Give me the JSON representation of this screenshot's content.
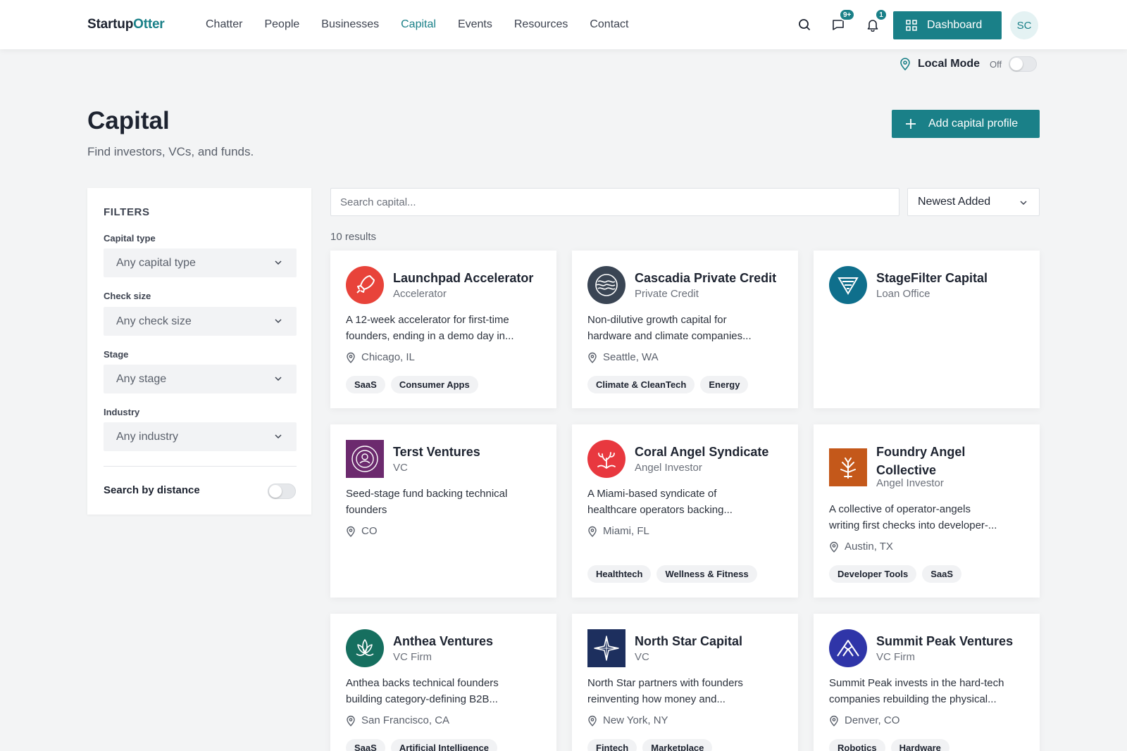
{
  "header": {
    "logo_part1": "Startup",
    "logo_part2": "Otter",
    "nav": [
      "Chatter",
      "People",
      "Businesses",
      "Capital",
      "Events",
      "Resources",
      "Contact"
    ],
    "active_nav": "Capital",
    "messages_badge": "9+",
    "notifications_badge": "1",
    "dashboard_label": "Dashboard",
    "avatar_initials": "SC"
  },
  "local_mode": {
    "label": "Local Mode",
    "state": "Off"
  },
  "page": {
    "title": "Capital",
    "subtitle": "Find investors, VCs, and funds.",
    "add_button": "Add capital profile"
  },
  "filters": {
    "title": "FILTERS",
    "capital_type": {
      "label": "Capital type",
      "value": "Any capital type"
    },
    "check_size": {
      "label": "Check size",
      "value": "Any check size"
    },
    "stage": {
      "label": "Stage",
      "value": "Any stage"
    },
    "industry": {
      "label": "Industry",
      "value": "Any industry"
    },
    "distance_label": "Search by distance"
  },
  "search": {
    "placeholder": "Search capital..."
  },
  "sort": {
    "value": "Newest Added"
  },
  "results_count": "10 results",
  "cards": [
    {
      "name": "Launchpad Accelerator",
      "type": "Accelerator",
      "desc1": "A 12-week accelerator for first-time",
      "desc2": "founders, ending in a demo day in...",
      "location": "Chicago, IL",
      "tags": [
        "SaaS",
        "Consumer Apps"
      ],
      "logo": "rocket-icon",
      "logo_color": "#e8433a"
    },
    {
      "name": "Cascadia Private Credit",
      "type": "Private Credit",
      "desc1": "Non-dilutive growth capital for",
      "desc2": "hardware and climate companies...",
      "location": "Seattle, WA",
      "tags": [
        "Climate & CleanTech",
        "Energy"
      ],
      "logo": "waves-icon",
      "logo_color": "#3a4554"
    },
    {
      "name": "StageFilter Capital",
      "type": "Loan Office",
      "logo": "chevron-shield-icon",
      "logo_color": "#0f6f8c",
      "tags": []
    },
    {
      "name": "Terst Ventures",
      "type": "VC",
      "desc1": "Seed-stage fund backing technical",
      "desc2": "founders",
      "location": "CO",
      "tags": [],
      "logo": "concentric-icon",
      "logo_color": "#6c2a6e"
    },
    {
      "name": "Coral Angel Syndicate",
      "type": "Angel Investor",
      "desc1": "A Miami-based syndicate of",
      "desc2": "healthcare operators backing...",
      "location": "Miami, FL",
      "tags": [
        "Healthtech",
        "Wellness & Fitness"
      ],
      "logo": "coral-icon",
      "logo_color": "#e8383f"
    },
    {
      "name_line1": "Foundry Angel",
      "name_line2": "Collective",
      "type": "Angel Investor",
      "desc1": "A collective of operator-angels",
      "desc2": "writing first checks into developer-...",
      "location": "Austin, TX",
      "tags": [
        "Developer Tools",
        "SaaS"
      ],
      "logo": "leaf-icon",
      "logo_color": "#c4581a"
    },
    {
      "name": "Anthea Ventures",
      "type": "VC Firm",
      "desc1": "Anthea backs technical founders",
      "desc2": "building category-defining B2B...",
      "location": "San Francisco, CA",
      "tags": [
        "SaaS",
        "Artificial Intelligence"
      ],
      "logo": "lotus-icon",
      "logo_color": "#166f5f"
    },
    {
      "name": "North Star Capital",
      "type": "VC",
      "desc1": "North Star partners with founders",
      "desc2": "reinventing how money and...",
      "location": "New York, NY",
      "tags": [
        "Fintech",
        "Marketplace"
      ],
      "logo": "star-icon",
      "logo_color": "#1d2f5e"
    },
    {
      "name": "Summit Peak Ventures",
      "type": "VC Firm",
      "desc1": "Summit Peak invests in the hard-tech",
      "desc2": "companies rebuilding the physical...",
      "location": "Denver, CO",
      "tags": [
        "Robotics",
        "Hardware"
      ],
      "logo": "mountain-icon",
      "logo_color": "#2f35a8"
    }
  ]
}
